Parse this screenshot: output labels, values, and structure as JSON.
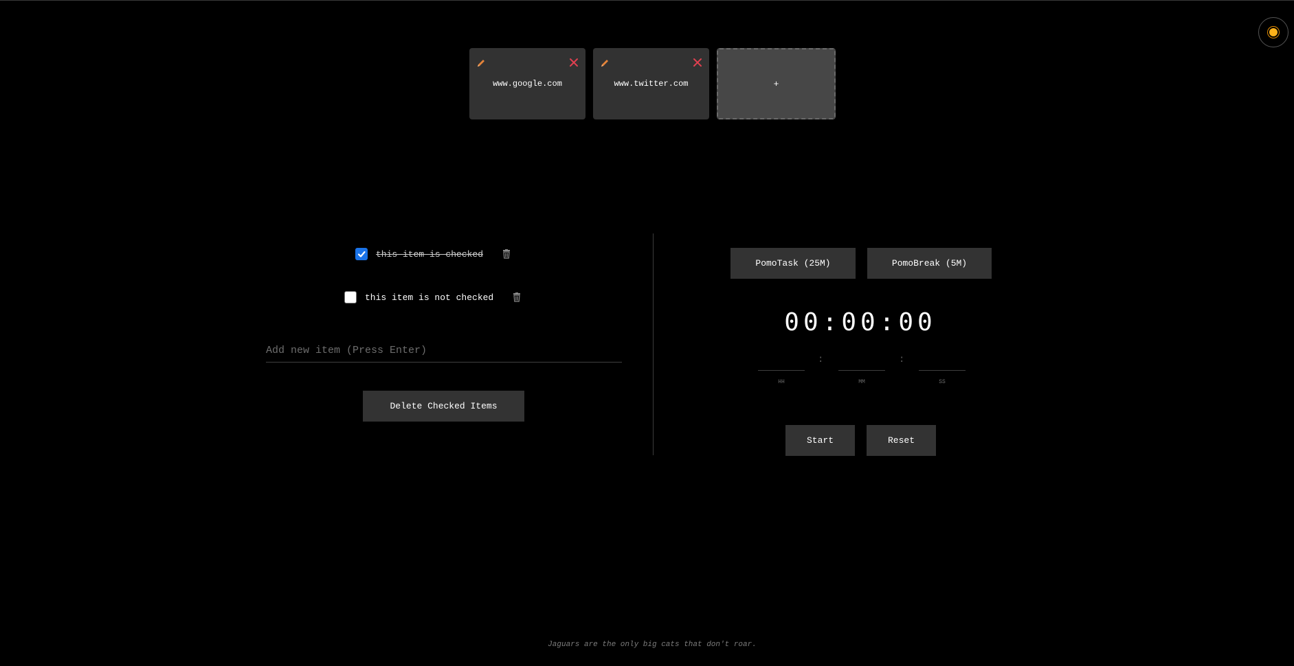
{
  "theme_toggle": {
    "icon": "sun-icon",
    "color": "#ffb21a"
  },
  "shortcuts": [
    {
      "url": "www.google.com"
    },
    {
      "url": "www.twitter.com"
    }
  ],
  "add_shortcut_label": "+",
  "icons": {
    "edit_color": "#e5843a",
    "close_color": "#e04050"
  },
  "todo": {
    "items": [
      {
        "label": "this item is checked",
        "checked": true
      },
      {
        "label": "this item is not checked",
        "checked": false
      }
    ],
    "new_item_placeholder": "Add new item (Press Enter)",
    "delete_checked_label": "Delete Checked Items"
  },
  "pomodoro": {
    "task_label": "PomoTask (25M)",
    "break_label": "PomoBreak (5M)",
    "display": "00:00:00",
    "separator": ":",
    "labels": {
      "hh": "HH",
      "mm": "MM",
      "ss": "SS"
    },
    "start_label": "Start",
    "reset_label": "Reset"
  },
  "fact": "Jaguars are the only big cats that don't roar.",
  "colors": {
    "background": "#000000",
    "card": "#323232",
    "button": "#333333",
    "checkbox_accent": "#1a73e8"
  }
}
